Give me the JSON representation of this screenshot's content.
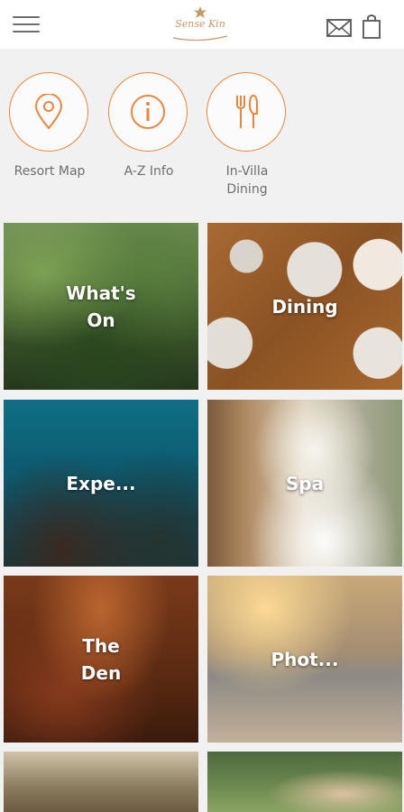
{
  "header": {
    "logo_text": "Sense Kin",
    "icons": [
      "menu-icon",
      "mail-icon",
      "shopping-bag-icon"
    ]
  },
  "quick_links": [
    {
      "label_lines": [
        "Resort Map"
      ],
      "icon": "map-pin-icon"
    },
    {
      "label_lines": [
        "A-Z Info"
      ],
      "icon": "info-icon"
    },
    {
      "label_lines": [
        "In-Villa",
        "Dining"
      ],
      "icon": "fork-knife-icon"
    }
  ],
  "tiles": [
    {
      "label_lines": [
        "What's",
        "On"
      ]
    },
    {
      "label_lines": [
        "Dining"
      ]
    },
    {
      "label_lines": [
        "Expe..."
      ]
    },
    {
      "label_lines": [
        "Spa"
      ]
    },
    {
      "label_lines": [
        "The",
        "Den"
      ]
    },
    {
      "label_lines": [
        "Phot..."
      ]
    }
  ],
  "colors": {
    "accent": "#e9853d",
    "logo": "#c49a64",
    "background": "#f1f1f1"
  }
}
